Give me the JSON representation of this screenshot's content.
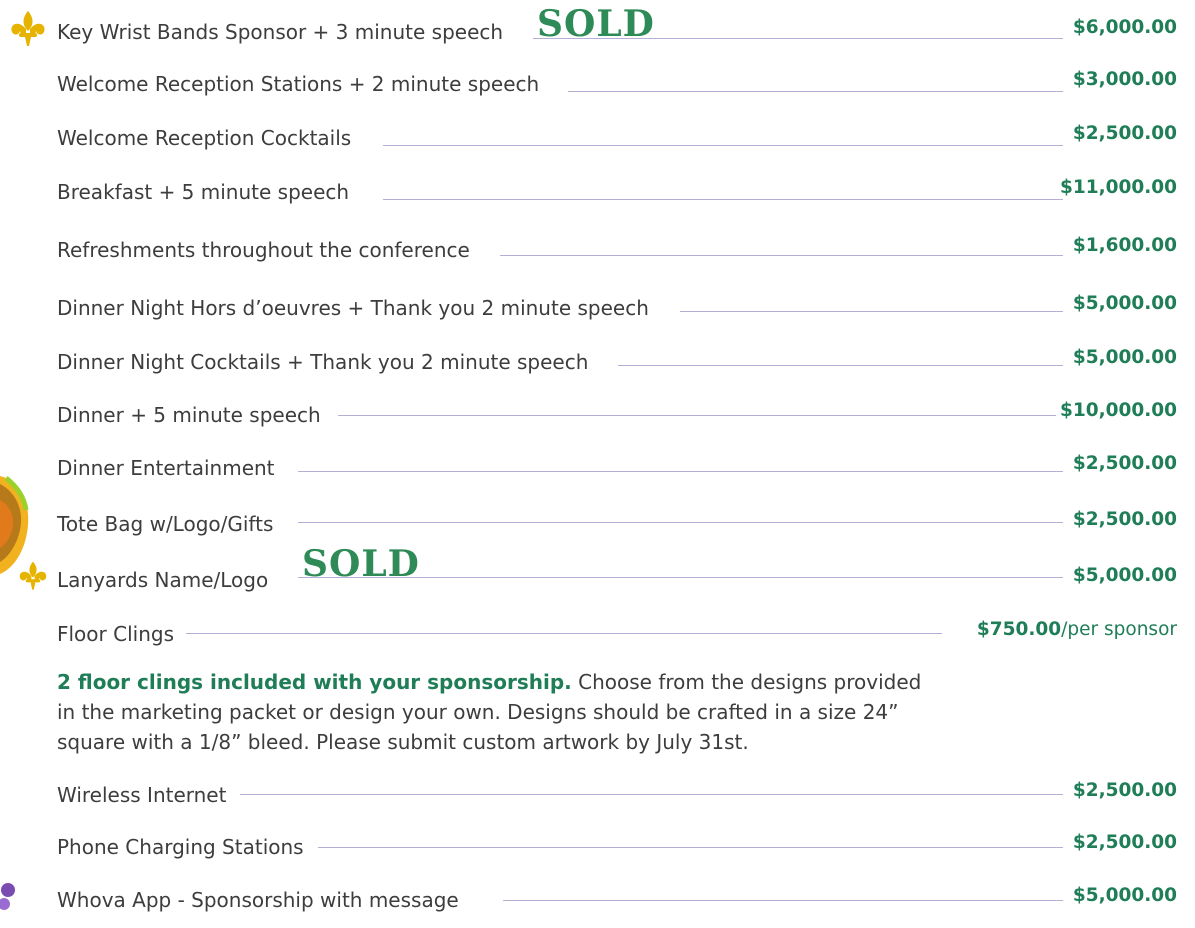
{
  "rows": [
    {
      "label": "Key Wrist Bands Sponsor + 3 minute speech",
      "price": "$6,000.00",
      "sold": "SOLD"
    },
    {
      "label": "Welcome Reception Stations + 2 minute speech",
      "price": "$3,000.00"
    },
    {
      "label": "Welcome Reception Cocktails",
      "price": "$2,500.00"
    },
    {
      "label": "Breakfast + 5 minute speech",
      "price": "$11,000.00"
    },
    {
      "label": "Refreshments throughout the conference",
      "price": "$1,600.00"
    },
    {
      "label": "Dinner Night Hors d’oeuvres + Thank you 2 minute speech",
      "price": "$5,000.00"
    },
    {
      "label": "Dinner Night Cocktails + Thank you 2 minute speech",
      "price": "$5,000.00"
    },
    {
      "label": "Dinner + 5 minute speech",
      "price": "$10,000.00"
    },
    {
      "label": "Dinner Entertainment",
      "price": "$2,500.00"
    },
    {
      "label": "Tote Bag w/Logo/Gifts",
      "price": "$2,500.00"
    },
    {
      "label": "Lanyards Name/Logo",
      "price": "$5,000.00",
      "sold": "SOLD"
    },
    {
      "label": "Floor Clings",
      "price": "$750.00",
      "unit": "/per sponsor"
    },
    {
      "label": "Wireless Internet",
      "price": "$2,500.00"
    },
    {
      "label": "Phone Charging Stations",
      "price": "$2,500.00"
    },
    {
      "label": "Whova App - Sponsorship with message",
      "price": "$5,000.00"
    }
  ],
  "floor_note": {
    "bold": "2 floor clings included with your sponsorship.",
    "text": " Choose from the designs provided in the marketing packet or design your own. Designs should be crafted in a size 24” square with a 1/8” bleed. Please submit custom artwork by July 31st."
  },
  "colors": {
    "price": "#1f7d58",
    "line": "#b5aed6",
    "fleur": "#e6b400"
  },
  "icons": [
    "fleur-de-lis-icon",
    "mask-decoration",
    "beads-decoration"
  ]
}
